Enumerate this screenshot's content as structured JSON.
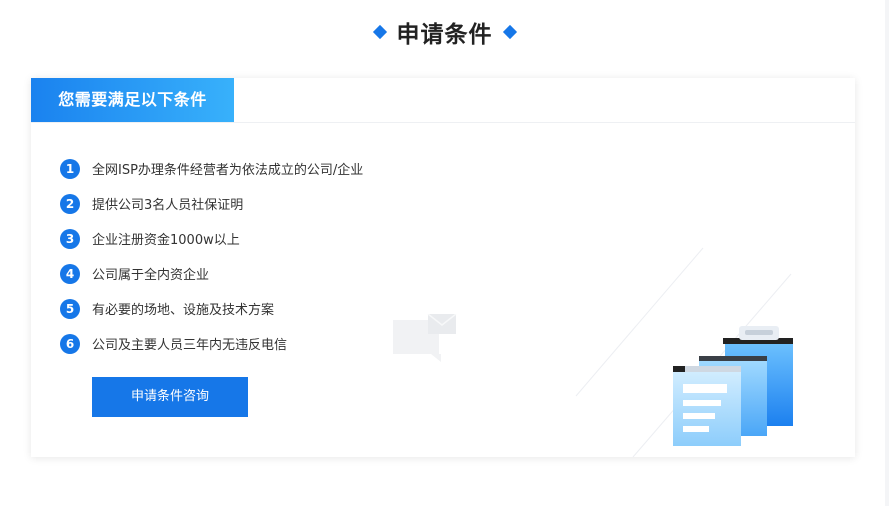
{
  "heading": {
    "title": "申请条件"
  },
  "card": {
    "tab_label": "您需要满足以下条件",
    "conditions": [
      {
        "num": "1",
        "text": "全网ISP办理条件经营者为依法成立的公司/企业"
      },
      {
        "num": "2",
        "text": "提供公司3名人员社保证明"
      },
      {
        "num": "3",
        "text": "企业注册资金1000w以上"
      },
      {
        "num": "4",
        "text": "公司属于全内资企业"
      },
      {
        "num": "5",
        "text": "有必要的场地、设施及技术方案"
      },
      {
        "num": "6",
        "text": "公司及主要人员三年内无违反电信"
      }
    ],
    "button_label": "申请条件咨询"
  },
  "colors": {
    "accent": "#1677e8",
    "tab_gradient_start": "#1a82ef",
    "tab_gradient_end": "#38b1fb",
    "text": "#333333",
    "title": "#222222"
  },
  "icons": [
    "diamond-icon",
    "chat-bubble-icon",
    "clipboard-documents-illustration"
  ]
}
